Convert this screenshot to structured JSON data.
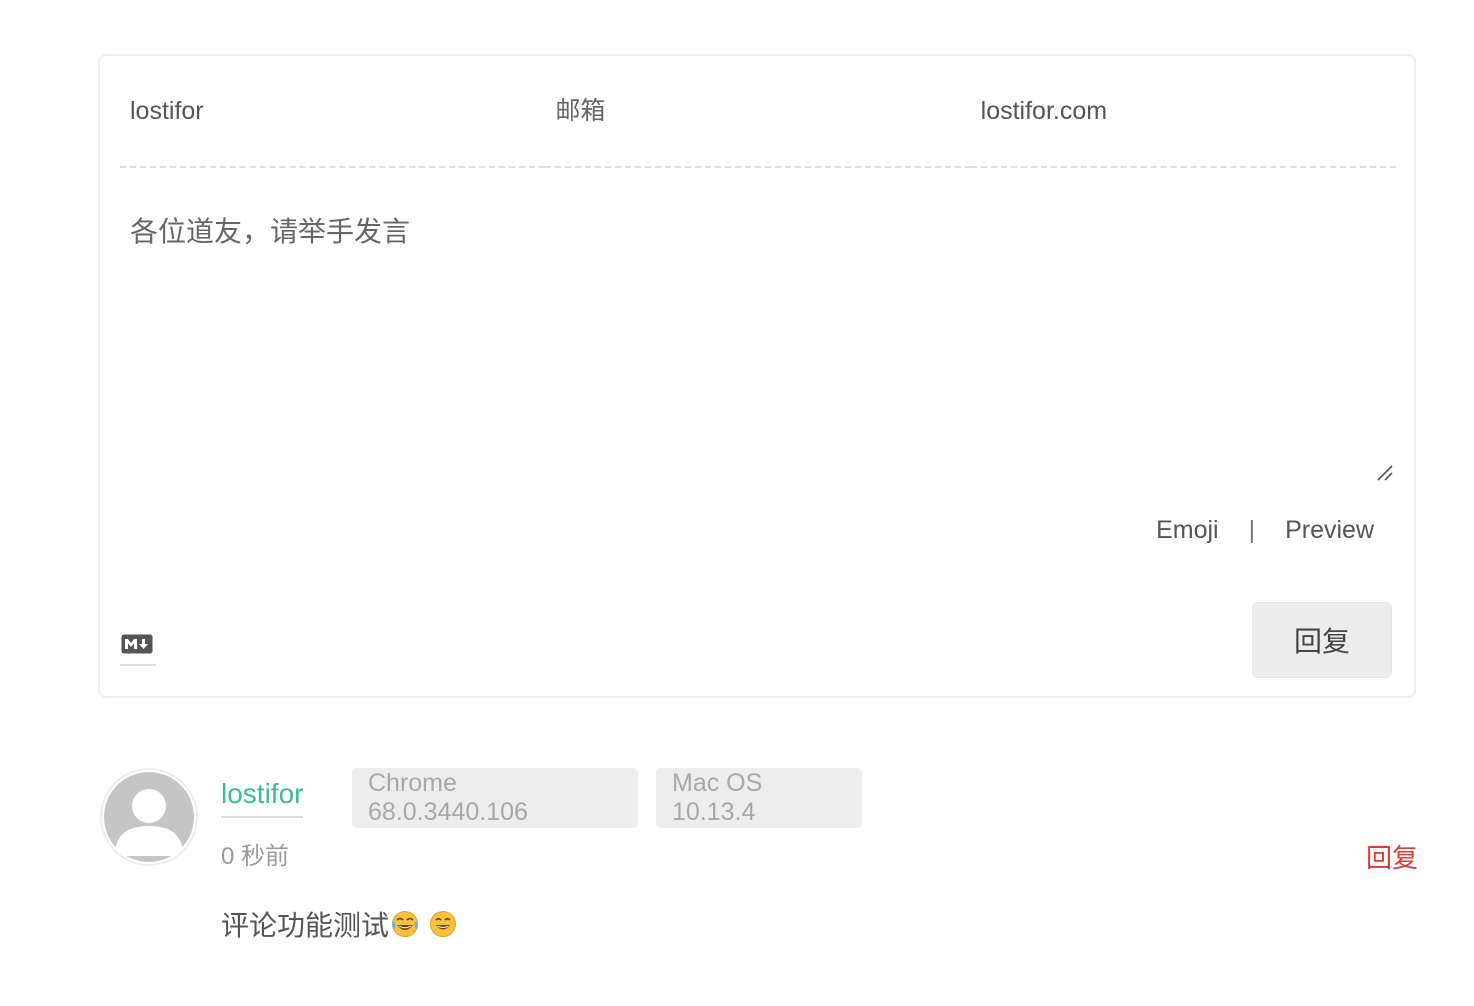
{
  "form": {
    "nick_value": "lostifor",
    "mail_placeholder": "邮箱",
    "link_value": "lostifor.com",
    "editor_placeholder": "各位道友，请举手发言",
    "tools": {
      "emoji_label": "Emoji",
      "separator": "|",
      "preview_label": "Preview"
    },
    "markdown_icon": "markdown-icon",
    "submit_label": "回复"
  },
  "comment": {
    "nick": "lostifor",
    "browser": "Chrome 68.0.3440.106",
    "os": "Mac OS 10.13.4",
    "time": "0 秒前",
    "reply_label": "回复",
    "text": "评论功能测试",
    "emojis": [
      "joy-emoji",
      "smile-emoji"
    ],
    "avatar_icon": "default-avatar-icon"
  },
  "colors": {
    "nick_accent": "#3bbb9b",
    "reply_link": "#e03a2e",
    "tag_background": "#ededed",
    "button_background": "#ececec"
  }
}
